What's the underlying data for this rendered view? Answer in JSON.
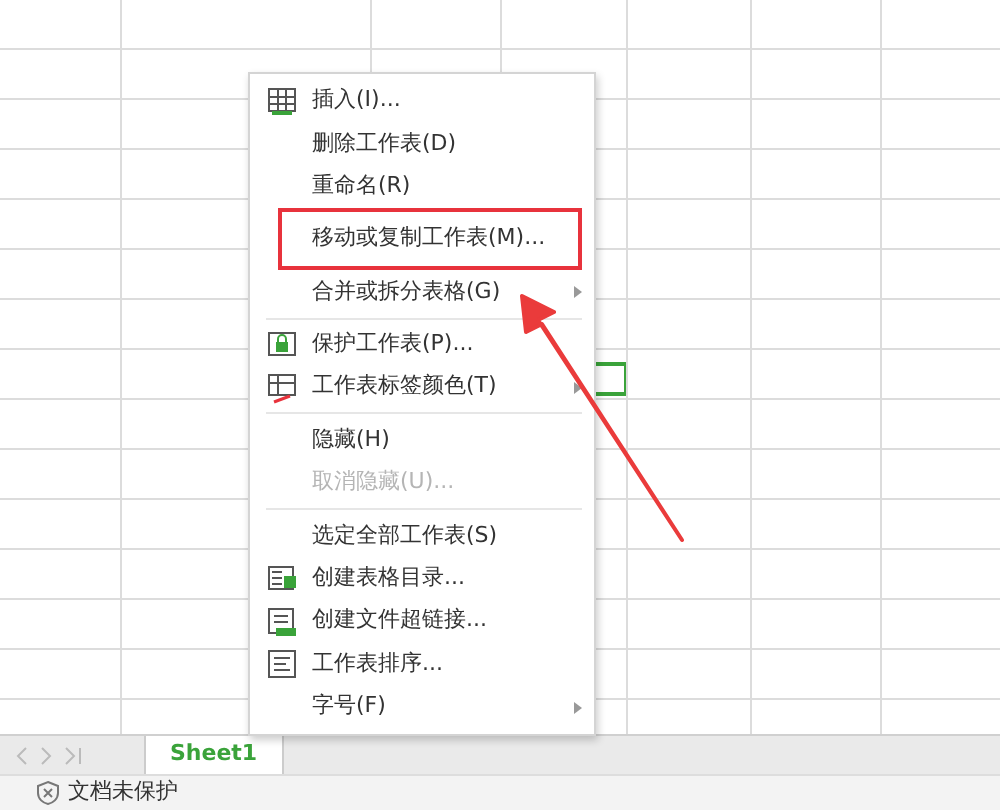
{
  "context_menu": {
    "items": [
      {
        "kind": "item",
        "label": "插入(I)...",
        "disabled": false,
        "submenu": false,
        "annotated": false
      },
      {
        "kind": "item",
        "label": "删除工作表(D)",
        "disabled": false,
        "submenu": false,
        "annotated": false
      },
      {
        "kind": "item",
        "label": "重命名(R)",
        "disabled": false,
        "submenu": false,
        "annotated": false
      },
      {
        "kind": "item",
        "label": "移动或复制工作表(M)...",
        "disabled": false,
        "submenu": false,
        "annotated": true
      },
      {
        "kind": "item",
        "label": "合并或拆分表格(G)",
        "disabled": false,
        "submenu": true,
        "annotated": false
      },
      {
        "kind": "separator"
      },
      {
        "kind": "item",
        "label": "保护工作表(P)...",
        "disabled": false,
        "submenu": false,
        "annotated": false
      },
      {
        "kind": "item",
        "label": "工作表标签颜色(T)",
        "disabled": false,
        "submenu": true,
        "annotated": false
      },
      {
        "kind": "separator"
      },
      {
        "kind": "item",
        "label": "隐藏(H)",
        "disabled": false,
        "submenu": false,
        "annotated": false
      },
      {
        "kind": "item",
        "label": "取消隐藏(U)...",
        "disabled": true,
        "submenu": false,
        "annotated": false
      },
      {
        "kind": "separator"
      },
      {
        "kind": "item",
        "label": "选定全部工作表(S)",
        "disabled": false,
        "submenu": false,
        "annotated": false
      },
      {
        "kind": "item",
        "label": "创建表格目录...",
        "disabled": false,
        "submenu": false,
        "annotated": false
      },
      {
        "kind": "item",
        "label": "创建文件超链接...",
        "disabled": false,
        "submenu": false,
        "annotated": false
      },
      {
        "kind": "item",
        "label": "工作表排序...",
        "disabled": false,
        "submenu": false,
        "annotated": false
      },
      {
        "kind": "item",
        "label": "字号(F)",
        "disabled": false,
        "submenu": true,
        "annotated": false
      }
    ]
  },
  "sheet_tabs": [
    {
      "label": "Sheet1",
      "selected": true
    }
  ],
  "status_bar": {
    "protection": "文档未保护"
  }
}
